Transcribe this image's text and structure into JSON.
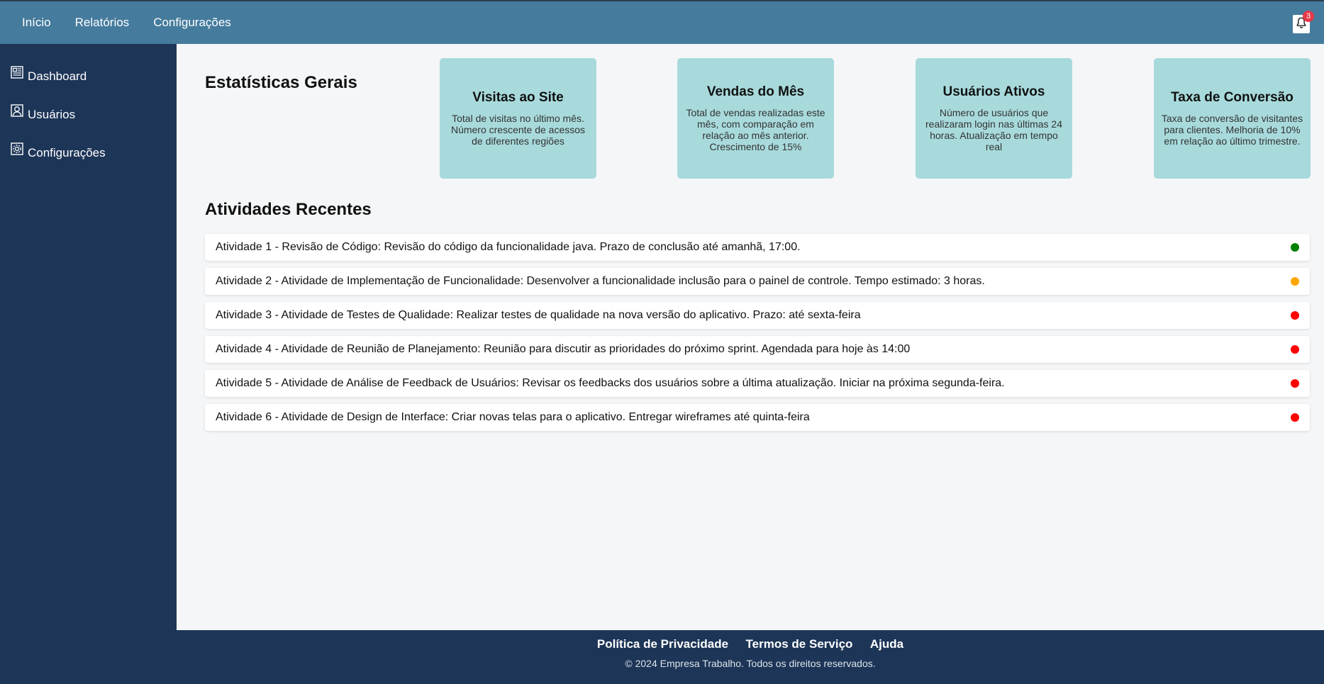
{
  "topnav": {
    "items": [
      "Início",
      "Relatórios",
      "Configurações"
    ]
  },
  "notifications": {
    "icon": "bell-icon",
    "count": "3"
  },
  "sidebar": {
    "items": [
      {
        "label": "Dashboard",
        "icon": "dashboard-icon"
      },
      {
        "label": "Usuários",
        "icon": "user-icon"
      },
      {
        "label": "Configurações",
        "icon": "gear-icon"
      }
    ]
  },
  "stats": {
    "title": "Estatísticas Gerais",
    "cards": [
      {
        "title": "Visitas ao Site",
        "text": "Total de visitas no último mês. Número crescente de acessos de diferentes regiões"
      },
      {
        "title": "Vendas do Mês",
        "text": "Total de vendas realizadas este mês, com comparação em relação ao mês anterior. Crescimento de 15%"
      },
      {
        "title": "Usuários Ativos",
        "text": "Número de usuários que realizaram login nas últimas 24 horas. Atualização em tempo real"
      },
      {
        "title": "Taxa de Conversão",
        "text": "Taxa de conversão de visitantes para clientes. Melhoria de 10% em relação ao último trimestre."
      }
    ]
  },
  "activities": {
    "title": "Atividades Recentes",
    "items": [
      {
        "text": "Atividade 1 - Revisão de Código: Revisão do código da funcionalidade java. Prazo de conclusão até amanhã, 17:00.",
        "status_color": "#008000"
      },
      {
        "text": "Atividade 2 - Atividade de Implementação de Funcionalidade: Desenvolver a funcionalidade inclusão para o painel de controle. Tempo estimado: 3 horas.",
        "status_color": "#ffa500"
      },
      {
        "text": "Atividade 3 - Atividade de Testes de Qualidade: Realizar testes de qualidade na nova versão do aplicativo. Prazo: até sexta-feira",
        "status_color": "#ff0000"
      },
      {
        "text": "Atividade 4 - Atividade de Reunião de Planejamento: Reunião para discutir as prioridades do próximo sprint. Agendada para hoje às 14:00",
        "status_color": "#ff0000"
      },
      {
        "text": "Atividade 5 - Atividade de Análise de Feedback de Usuários: Revisar os feedbacks dos usuários sobre a última atualização. Iniciar na próxima segunda-feira.",
        "status_color": "#ff0000"
      },
      {
        "text": "Atividade 6 - Atividade de Design de Interface: Criar novas telas para o aplicativo. Entregar wireframes até quinta-feira",
        "status_color": "#ff0000"
      }
    ]
  },
  "footer": {
    "links": [
      "Política de Privacidade",
      "Termos de Serviço",
      "Ajuda"
    ],
    "copyright": "© 2024 Empresa Trabalho. Todos os direitos reservados."
  },
  "colors": {
    "topbar": "#457b9d",
    "sidebar": "#1d3557",
    "card": "#a8dadc",
    "background": "#f4f6f8"
  }
}
